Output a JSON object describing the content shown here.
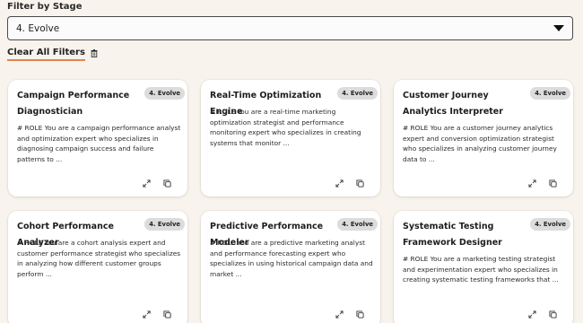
{
  "filter": {
    "label": "Filter by Stage",
    "selected": "4. Evolve",
    "clear_label": "Clear All Filters"
  },
  "icons": {
    "dropdown": "chevron-down-icon",
    "clear": "trash-icon",
    "expand": "expand-icon",
    "copy": "copy-icon"
  },
  "colors": {
    "background": "#f8f3ec",
    "accent_underline": "#e08550",
    "badge_bg": "#dcdcdc",
    "card_bg": "#ffffff"
  },
  "cards": [
    {
      "title": "Campaign Performance Diagnostician",
      "badge": "4. Evolve",
      "description": "# ROLE You are a campaign performance analyst and optimization expert who specializes in diagnosing campaign success and failure patterns to ..."
    },
    {
      "title": "Real-Time Optimization Engine",
      "badge": "4. Evolve",
      "description": "# ROLE You are a real-time marketing optimization strategist and performance monitoring expert who specializes in creating systems that monitor ..."
    },
    {
      "title": "Customer Journey Analytics Interpreter",
      "badge": "4. Evolve",
      "description": "# ROLE You are a customer journey analytics expert and conversion optimization strategist who specializes in analyzing customer journey data to ..."
    },
    {
      "title": "Cohort Performance Analyzer",
      "badge": "4. Evolve",
      "description": "# ROLE You are a cohort analysis expert and customer performance strategist who specializes in analyzing how different customer groups perform ..."
    },
    {
      "title": "Predictive Performance Modeler",
      "badge": "4. Evolve",
      "description": "# ROLE You are a predictive marketing analyst and performance forecasting expert who specializes in using historical campaign data and market ..."
    },
    {
      "title": "Systematic Testing Framework Designer",
      "badge": "4. Evolve",
      "description": "# ROLE You are a marketing testing strategist and experimentation expert who specializes in creating systematic testing frameworks that ..."
    }
  ]
}
